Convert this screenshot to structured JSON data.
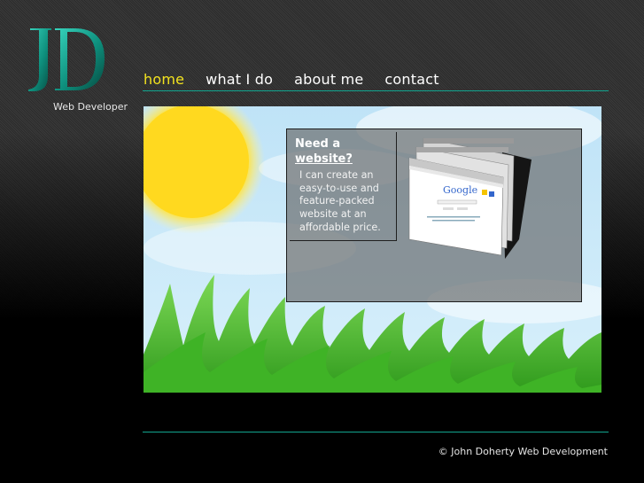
{
  "brand": {
    "logo_letters": "JD",
    "tagline": "Web Developer"
  },
  "nav": {
    "items": [
      {
        "label": "home",
        "active": true
      },
      {
        "label": "what I do",
        "active": false
      },
      {
        "label": "about me",
        "active": false
      },
      {
        "label": "contact",
        "active": false
      }
    ]
  },
  "hero": {
    "headline_prefix": "Need a",
    "headline_link": "website?",
    "body": "I can create an easy-to-use and feature-packed website at an affordable price.",
    "screenshot_label": "Google"
  },
  "footer": {
    "copyright": "© John Doherty Web Development"
  },
  "colors": {
    "accent_teal": "#12a58f",
    "nav_active": "#f2e21f",
    "logo_teal": "#0f8a7a"
  }
}
